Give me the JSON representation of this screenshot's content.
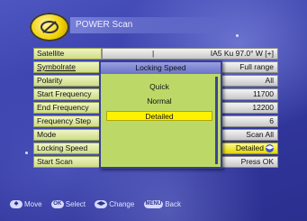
{
  "header": {
    "title": "POWER Scan",
    "logo_icon": "satellite-dish-icon"
  },
  "menu": {
    "rows": [
      {
        "label": "Satellite",
        "value": "IA5 Ku  97.0° W [+]",
        "mark": "|"
      },
      {
        "label": "Symbolrate",
        "value": "Full range"
      },
      {
        "label": "Polarity",
        "value": "All"
      },
      {
        "label": "Start Frequency",
        "value": "11700"
      },
      {
        "label": "End Frequency",
        "value": "12200"
      },
      {
        "label": "Frequency Step",
        "value": "6"
      },
      {
        "label": "Mode",
        "value": "Scan All"
      },
      {
        "label": "Locking Speed",
        "value": "Detailed"
      },
      {
        "label": "Start Scan",
        "value": "Press OK"
      }
    ]
  },
  "popup": {
    "title": "Locking Speed",
    "options": [
      "Quick",
      "Normal",
      "Detailed"
    ],
    "selected": "Detailed"
  },
  "footer": {
    "hints": [
      {
        "button": "◆",
        "label": "Move"
      },
      {
        "button": "OK",
        "label": "Select"
      },
      {
        "button": "◀▶",
        "label": "Change"
      },
      {
        "button": "MENU",
        "label": "Back"
      }
    ]
  },
  "colors": {
    "background": "#343aa4",
    "label_bg": "#dfe8a6",
    "value_bg": "#dcdcdc",
    "selected": "#fff200",
    "popup_bg": "#bcd968"
  }
}
